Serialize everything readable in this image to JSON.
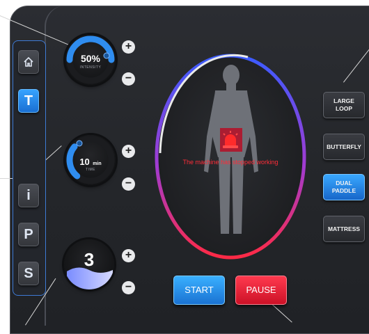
{
  "sidebar": {
    "items": [
      {
        "label": "",
        "icon": "home-icon"
      },
      {
        "label": "T",
        "active": true
      },
      {
        "label": "i"
      },
      {
        "label": "P"
      },
      {
        "label": "S"
      }
    ]
  },
  "controls": {
    "intensity": {
      "value": "50%",
      "caption": "INTENSITY",
      "level": 0.5
    },
    "time": {
      "value": "10",
      "unit": "min",
      "caption": "TIME",
      "level": 0.25
    },
    "level": {
      "value": "3",
      "fill": 0.35
    }
  },
  "modes": [
    {
      "label": "LARGE\nLOOP",
      "active": false
    },
    {
      "label": "BUTTERFLY",
      "active": false
    },
    {
      "label": "DUAL\nPADDLE",
      "active": true
    },
    {
      "label": "MATTRESS",
      "active": false
    }
  ],
  "status_message": "The machine has stopped working",
  "actions": {
    "start": "START",
    "pause": "PAUSE"
  },
  "colors": {
    "accent": "#2b8ef0",
    "alert": "#ff2c38",
    "panel": "#26282c"
  }
}
